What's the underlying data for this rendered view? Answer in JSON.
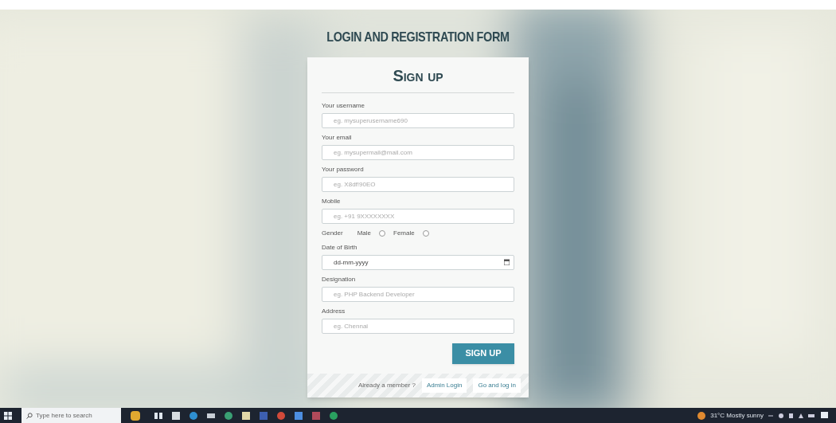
{
  "page": {
    "heading": "LOGIN AND REGISTRATION FORM"
  },
  "form": {
    "title": "Sign up",
    "fields": [
      {
        "kind": "text",
        "label": "Your username",
        "placeholder": "eg. mysuperusername690"
      },
      {
        "kind": "text",
        "label": "Your email",
        "placeholder": "eg. mysupermail@mail.com"
      },
      {
        "kind": "text",
        "label": "Your password",
        "placeholder": "eg. X8df!90EO"
      },
      {
        "kind": "text",
        "label": "Mobile",
        "placeholder": "eg. +91 9XXXXXXXX"
      },
      {
        "kind": "radio",
        "label": "Gender",
        "options": [
          {
            "label": "Male",
            "selected": false
          },
          {
            "label": "Female",
            "selected": false
          }
        ]
      },
      {
        "kind": "date",
        "label": "Date of Birth",
        "placeholder": "dd-mm-yyyy"
      },
      {
        "kind": "text",
        "label": "Designation",
        "placeholder": "eg. PHP Backend Developer"
      },
      {
        "kind": "text",
        "label": "Address",
        "placeholder": "eg. Chennai"
      }
    ],
    "submit": "SIGN UP",
    "footer": {
      "prompt": "Already a member ?",
      "links": [
        "Admin Login",
        "Go and log in"
      ]
    }
  },
  "taskbar": {
    "search_placeholder": "Type here to search",
    "weather": "31°C Mostly sunny"
  }
}
